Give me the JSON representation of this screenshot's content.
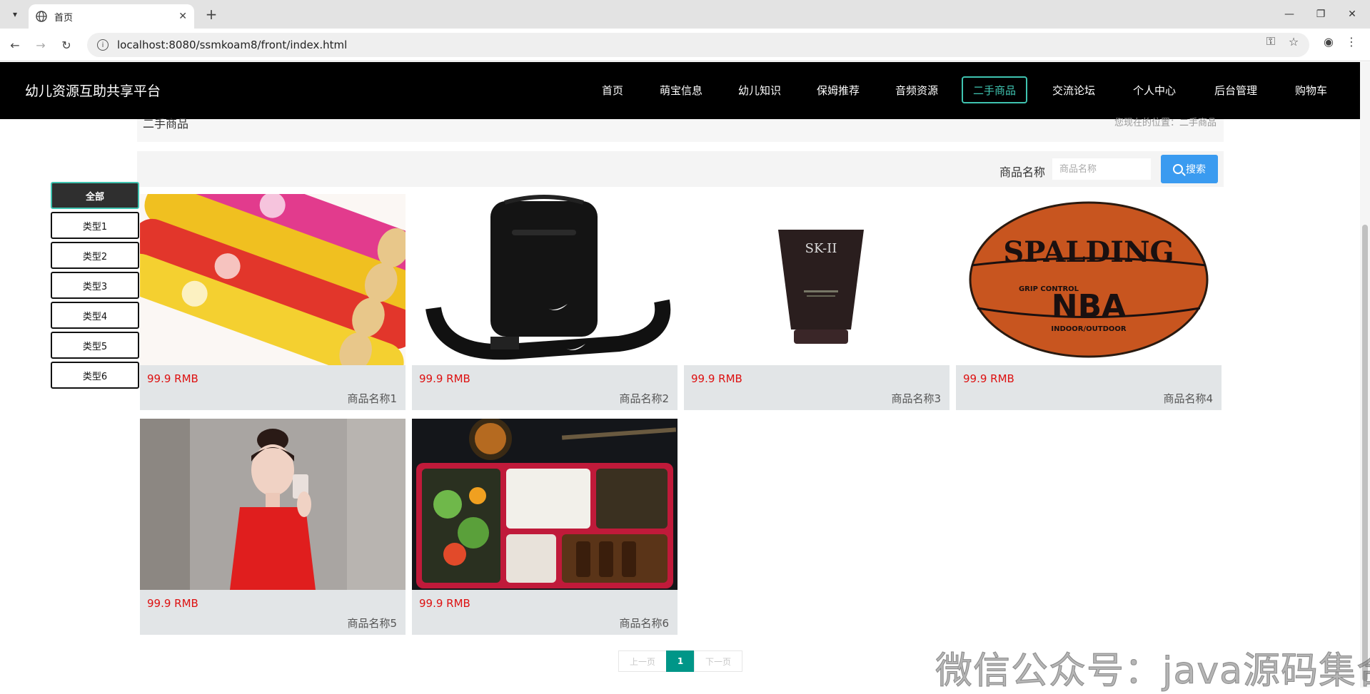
{
  "browser": {
    "tab_title": "首页",
    "url": "localhost:8080/ssmkoam8/front/index.html"
  },
  "header": {
    "site_title": "幼儿资源互助共享平台",
    "nav": [
      "首页",
      "萌宝信息",
      "幼儿知识",
      "保姆推荐",
      "音频资源",
      "二手商品",
      "交流论坛",
      "个人中心",
      "后台管理",
      "购物车"
    ],
    "active_nav": "二手商品"
  },
  "breadcrumb": {
    "title": "二手商品",
    "location": "您现在的位置：二手商品"
  },
  "search": {
    "label": "商品名称",
    "placeholder": "商品名称",
    "button": "搜索"
  },
  "categories": [
    "全部",
    "类型1",
    "类型2",
    "类型3",
    "类型4",
    "类型5",
    "类型6"
  ],
  "products": [
    {
      "price": "99.9 RMB",
      "name": "商品名称1",
      "image": "chips-cans"
    },
    {
      "price": "99.9 RMB",
      "name": "商品名称2",
      "image": "black-shoulder-bag"
    },
    {
      "price": "99.9 RMB",
      "name": "商品名称3",
      "image": "skincare-tube"
    },
    {
      "price": "99.9 RMB",
      "name": "商品名称4",
      "image": "basketball"
    },
    {
      "price": "99.9 RMB",
      "name": "商品名称5",
      "image": "woman-red-top"
    },
    {
      "price": "99.9 RMB",
      "name": "商品名称6",
      "image": "bento-box"
    }
  ],
  "product_image_text": {
    "skincare_brand": "SK-II",
    "basketball_brand": "SPALDING",
    "basketball_line1": "GRIP CONTROL",
    "basketball_league": "NBA",
    "basketball_line2": "INDOOR/OUTDOOR"
  },
  "pagination": {
    "prev": "上一页",
    "current": "1",
    "next": "下一页"
  },
  "watermark": "微信公众号：java源码集合"
}
